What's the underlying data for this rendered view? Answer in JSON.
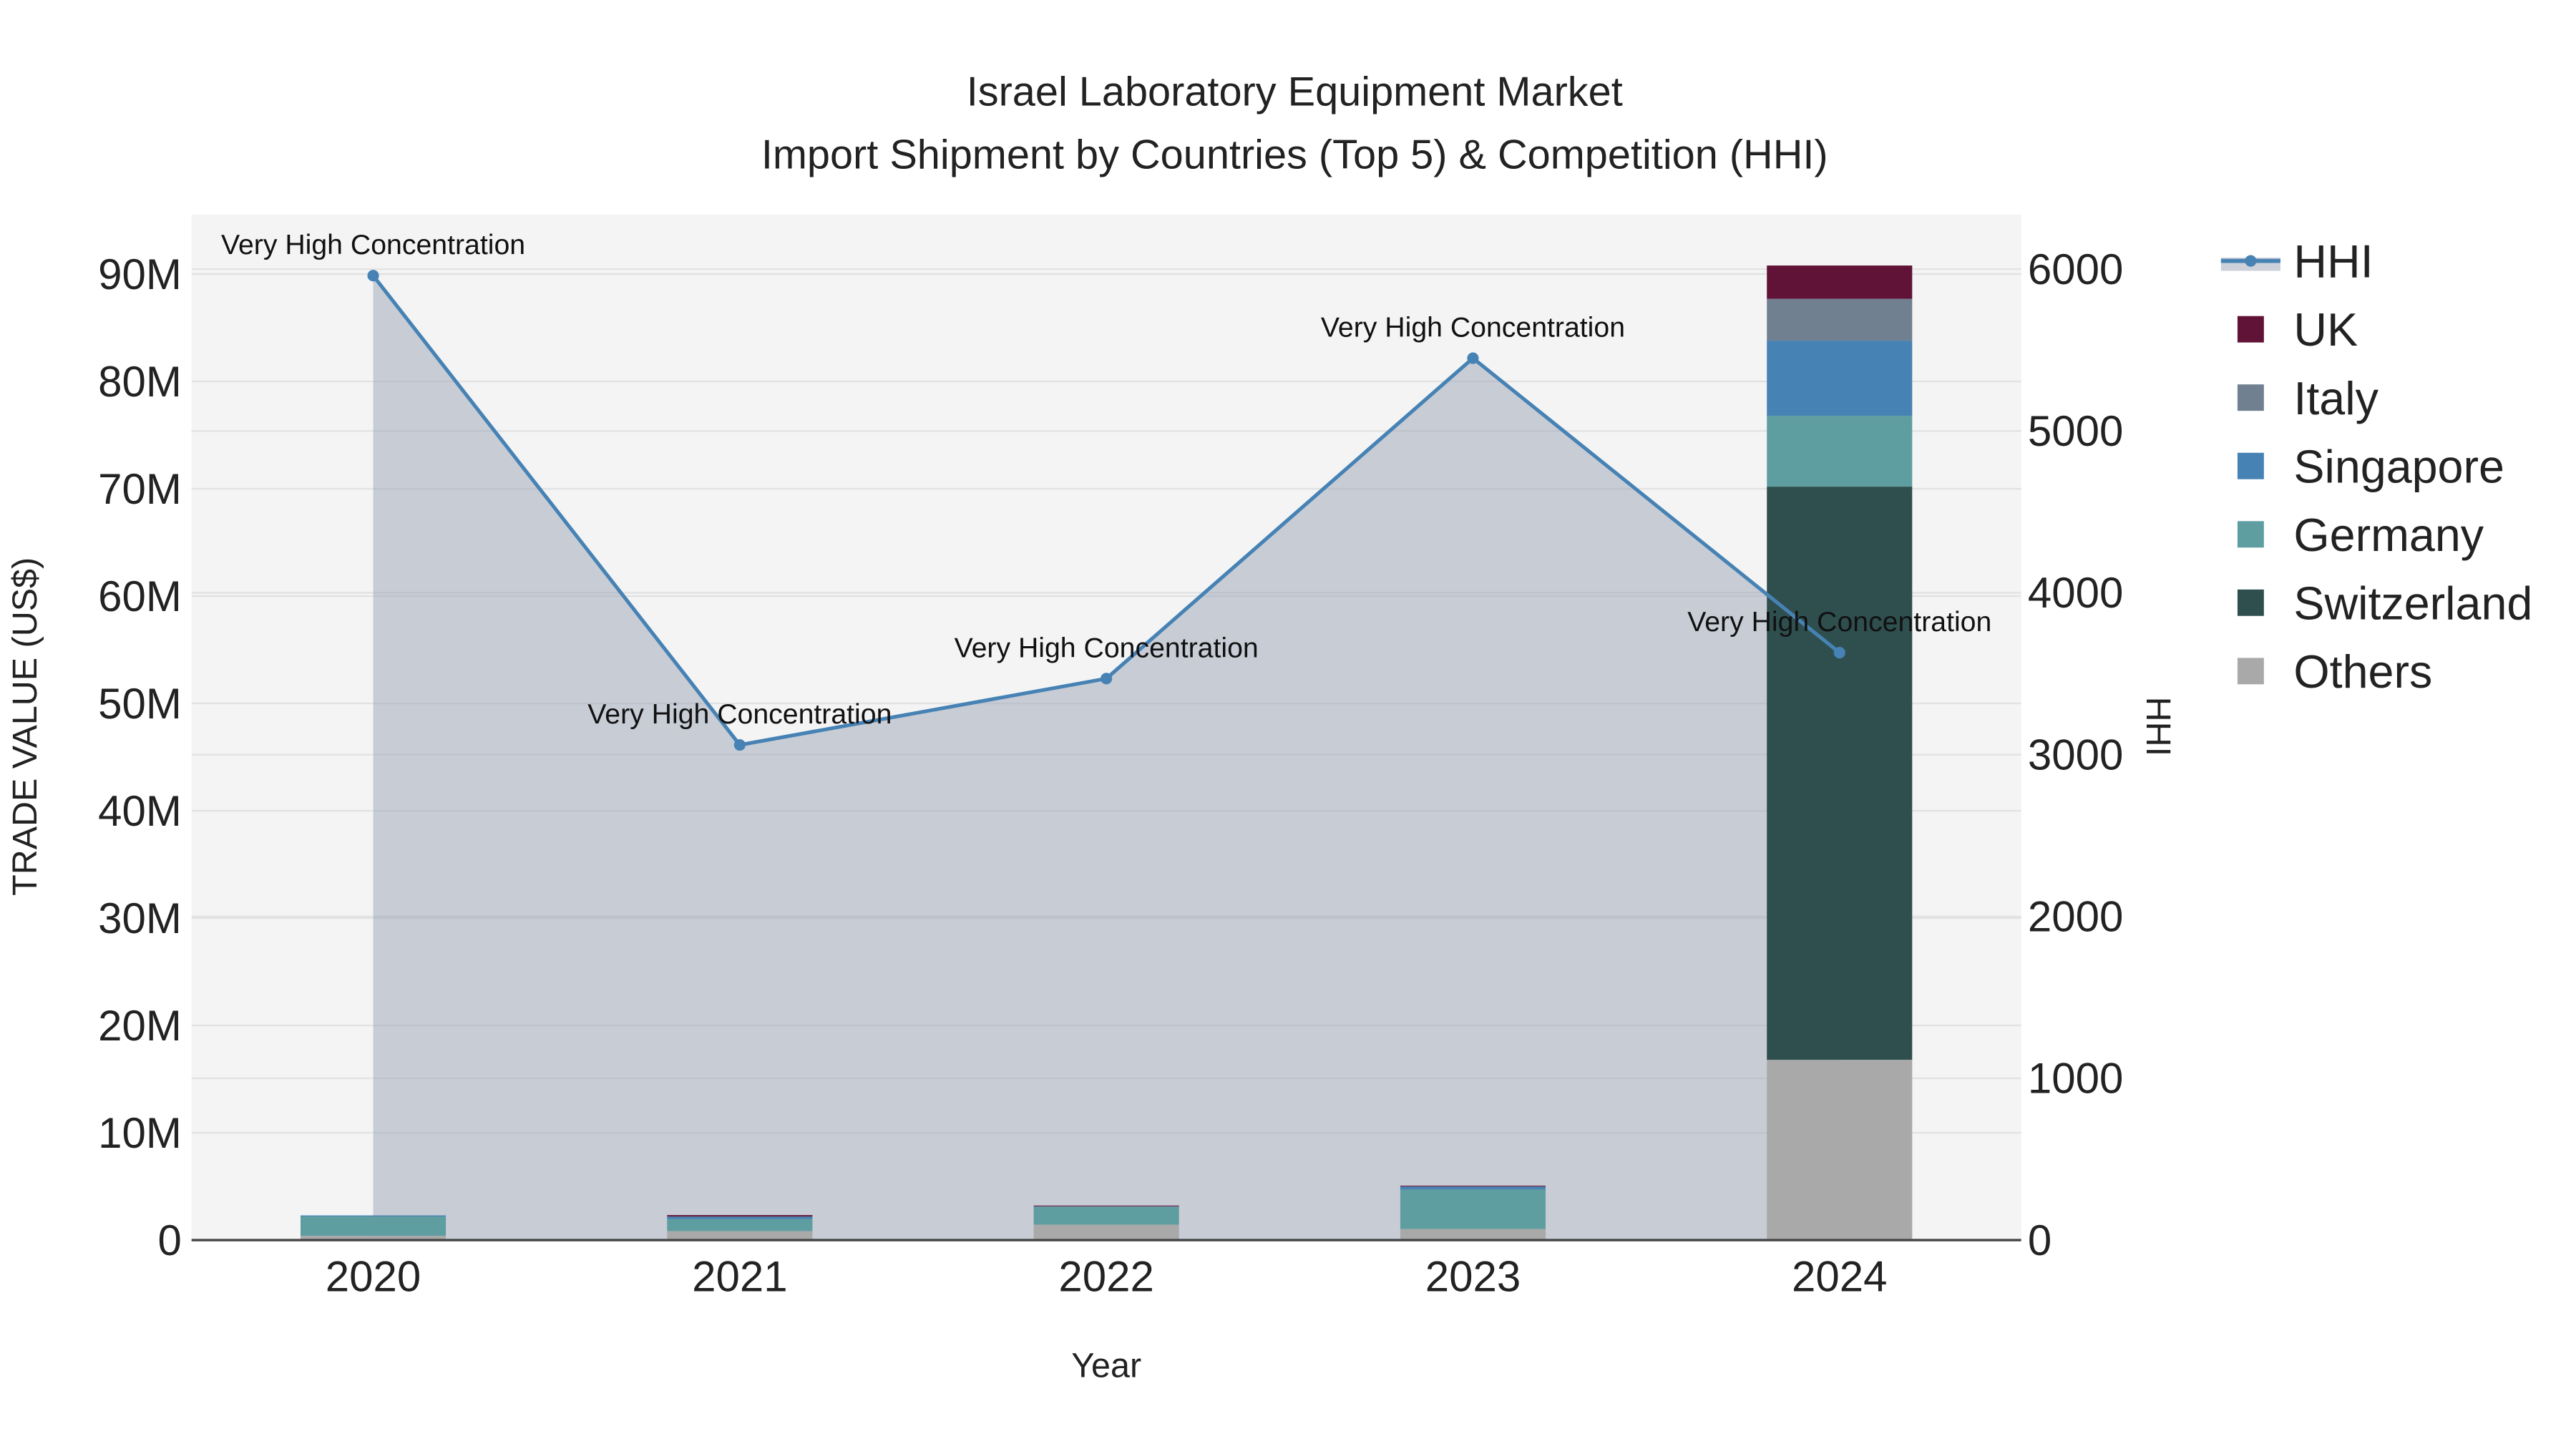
{
  "chart_data": {
    "type": "bar",
    "title": "Israel Laboratory Equipment Market",
    "subtitle": "Import Shipment by Countries (Top 5) & Competition (HHI)",
    "xlabel": "Year",
    "ylabel": "TRADE VALUE (US$)",
    "y2label": "HHI",
    "categories": [
      "2020",
      "2021",
      "2022",
      "2023",
      "2024"
    ],
    "ylim": [
      0,
      95
    ],
    "y_unit": "M",
    "y_ticks": [
      "0",
      "10M",
      "20M",
      "30M",
      "40M",
      "50M",
      "60M",
      "70M",
      "80M",
      "90M"
    ],
    "y2lim": [
      0,
      6330
    ],
    "y2_ticks": [
      "0",
      "1000",
      "2000",
      "3000",
      "4000",
      "5000",
      "6000"
    ],
    "stacked": true,
    "series": [
      {
        "name": "Others",
        "color": "#a9a9a9",
        "values": [
          0.4,
          0.84,
          1.44,
          1.04,
          16.8
        ]
      },
      {
        "name": "Switzerland",
        "color": "#2f4f4f",
        "values": [
          0,
          0,
          0,
          0,
          53.4
        ]
      },
      {
        "name": "Germany",
        "color": "#5f9ea0",
        "values": [
          1.8,
          1.13,
          1.67,
          3.67,
          6.6
        ]
      },
      {
        "name": "Singapore",
        "color": "#4682b4",
        "values": [
          0.1,
          0.2,
          0.02,
          0.27,
          7.0
        ]
      },
      {
        "name": "Italy",
        "color": "#708090",
        "values": [
          0,
          0.03,
          0.02,
          0.02,
          3.9
        ]
      },
      {
        "name": "UK",
        "color": "#601336",
        "values": [
          0,
          0.13,
          0.07,
          0.07,
          3.1
        ]
      }
    ],
    "line": {
      "name": "HHI",
      "color": "#4682b4",
      "fill": "#9aa3b5",
      "values": [
        5960,
        3060,
        3470,
        5450,
        3630
      ],
      "annotations": [
        "Very High Concentration",
        "Very High Concentration",
        "Very High Concentration",
        "Very High Concentration",
        "Very High Concentration"
      ]
    },
    "legend": {
      "position": "right",
      "order": [
        "HHI",
        "UK",
        "Italy",
        "Singapore",
        "Germany",
        "Switzerland",
        "Others"
      ]
    },
    "grid": true
  }
}
